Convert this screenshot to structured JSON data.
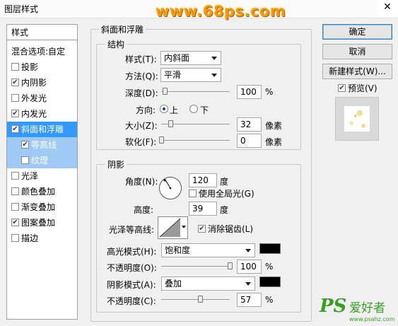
{
  "window": {
    "title": "图层样式",
    "close": "✕",
    "watermark": "www.68ps.com"
  },
  "left": {
    "header": "样式",
    "blend": "混合选项:自定",
    "items": [
      {
        "label": "投影",
        "checked": false
      },
      {
        "label": "内阴影",
        "checked": true
      },
      {
        "label": "外发光",
        "checked": false
      },
      {
        "label": "内发光",
        "checked": true
      },
      {
        "label": "斜面和浮雕",
        "checked": true
      },
      {
        "label": "等高线",
        "checked": true
      },
      {
        "label": "纹理",
        "checked": false
      },
      {
        "label": "光泽",
        "checked": false
      },
      {
        "label": "颜色叠加",
        "checked": false
      },
      {
        "label": "渐变叠加",
        "checked": false
      },
      {
        "label": "图案叠加",
        "checked": true
      },
      {
        "label": "描边",
        "checked": false
      }
    ]
  },
  "bevel": {
    "title": "斜面和浮雕",
    "structure": {
      "title": "结构",
      "style_label": "样式(T):",
      "style_value": "内斜面",
      "method_label": "方法(Q):",
      "method_value": "平滑",
      "depth_label": "深度(D):",
      "depth_value": "100",
      "depth_unit": "%",
      "depth_level": 0.05,
      "direction_label": "方向:",
      "dir_up": "上",
      "dir_down": "下",
      "size_label": "大小(Z):",
      "size_value": "32",
      "size_unit": "像素",
      "size_level": 0.13,
      "soften_label": "软化(F):",
      "soften_value": "0",
      "soften_unit": "像素",
      "soften_level": 0.0
    },
    "shading": {
      "title": "阴影",
      "angle_label": "角度(N):",
      "angle_value": "120",
      "angle_unit": "度",
      "global_light": "使用全局光(G)",
      "altitude_label": "高度:",
      "altitude_value": "39",
      "altitude_unit": "度",
      "gloss_label": "光泽等高线:",
      "antialias": "消除锯齿(L)",
      "hl_mode_label": "高光模式(H):",
      "hl_mode_value": "饱和度",
      "hl_color": "#000000",
      "hl_opacity_label": "不透明度(O):",
      "hl_opacity_value": "100",
      "hl_opacity_unit": "%",
      "hl_opacity_level": 1.0,
      "sh_mode_label": "阴影模式(A):",
      "sh_mode_value": "叠加",
      "sh_color": "#000000",
      "sh_opacity_label": "不透明度(C):",
      "sh_opacity_value": "57",
      "sh_opacity_unit": "%",
      "sh_opacity_level": 0.57
    }
  },
  "buttons": {
    "ok": "确定",
    "cancel": "取消",
    "new_style": "新建样式(W)...",
    "preview": "预览(V)"
  },
  "logo": {
    "ps": "PS",
    "text": "爱好者",
    "url": "www.psahz.com"
  }
}
